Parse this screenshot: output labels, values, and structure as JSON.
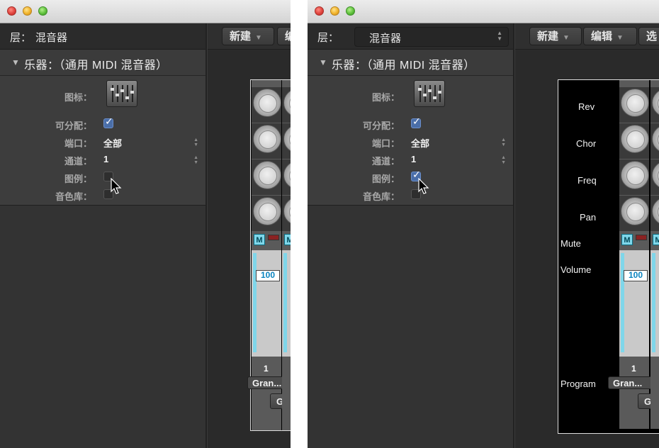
{
  "windows": {
    "left": {
      "layer": {
        "label": "层：",
        "value": "混音器"
      },
      "instrument": {
        "label": "乐器：",
        "value": "（通用 MIDI 混音器）"
      },
      "props": {
        "icon_label": "图标：",
        "assignable_label": "可分配：",
        "assignable": true,
        "port_label": "端口：",
        "port_value": "全部",
        "channel_label": "通道：",
        "channel_value": "1",
        "legend_label": "图例：",
        "legend": false,
        "soundbank_label": "音色库：",
        "soundbank": false
      },
      "toolbar": {
        "new": "新建",
        "edit_partial": "编"
      },
      "strip": {
        "volume": "100",
        "channel_number": "1",
        "program": "Gran...",
        "gr_button": "Gr"
      }
    },
    "right": {
      "layer": {
        "label": "层：",
        "value": "混音器"
      },
      "instrument": {
        "label": "乐器：",
        "value": "（通用 MIDI 混音器）"
      },
      "props": {
        "icon_label": "图标：",
        "assignable_label": "可分配：",
        "assignable": true,
        "port_label": "端口：",
        "port_value": "全部",
        "channel_label": "通道：",
        "channel_value": "1",
        "legend_label": "图例：",
        "legend": true,
        "soundbank_label": "音色库：",
        "soundbank": false
      },
      "toolbar": {
        "new": "新建",
        "edit": "编辑",
        "select_partial": "选"
      },
      "row_labels": {
        "rev": "Rev",
        "chor": "Chor",
        "freq": "Freq",
        "pan": "Pan",
        "mute": "Mute",
        "volume": "Volume",
        "program": "Program"
      },
      "strip": {
        "volume": "100",
        "channel_number": "1",
        "program": "Gran...",
        "gr_button": "Gr"
      }
    }
  },
  "icons": {
    "disclosure": "disclosure-triangle-icon",
    "mute": "mute-button-icon",
    "cursor": "arrow-cursor-icon"
  }
}
